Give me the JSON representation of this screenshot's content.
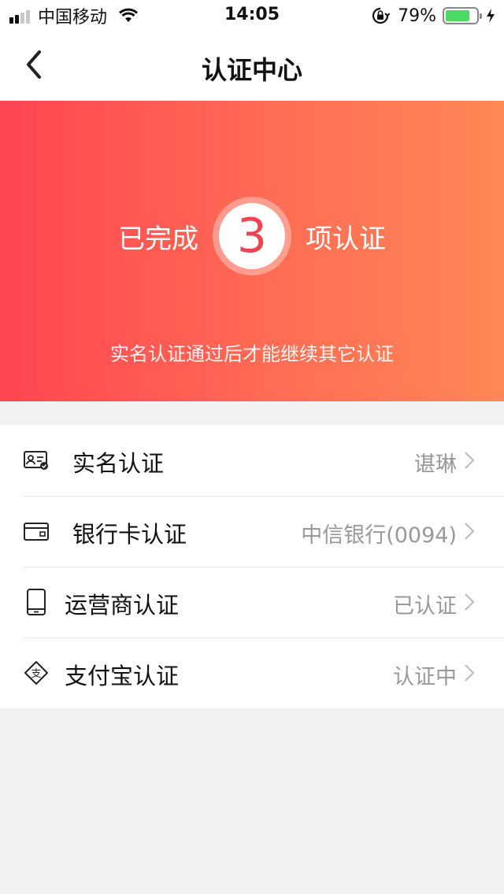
{
  "status_bar": {
    "carrier": "中国移动",
    "time": "14:05",
    "battery_percent": "79%",
    "battery_level": 0.79,
    "battery_color": "#4cd964",
    "icons": [
      "signal-icon",
      "wifi-icon",
      "rotation-lock-icon",
      "battery-icon",
      "charging-icon"
    ]
  },
  "nav": {
    "title": "认证中心",
    "back_icon": "chevron-left-icon"
  },
  "hero": {
    "prefix": "已完成",
    "count": "3",
    "suffix": "项认证",
    "note": "实名认证通过后才能继续其它认证",
    "gradient": [
      "#ff4452",
      "#ff8756"
    ]
  },
  "items": [
    {
      "label": "实名认证",
      "value": "谌琳",
      "icon": "id-card-icon"
    },
    {
      "label": "银行卡认证",
      "value": "中信银行(0094)",
      "icon": "bank-card-icon"
    },
    {
      "label": "运营商认证",
      "value": "已认证",
      "icon": "phone-icon"
    },
    {
      "label": "支付宝认证",
      "value": "认证中",
      "icon": "alipay-icon"
    }
  ]
}
